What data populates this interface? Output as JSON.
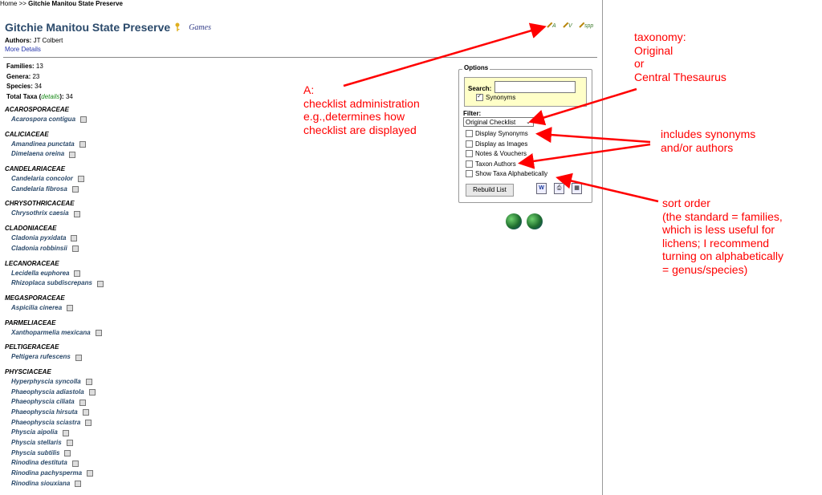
{
  "breadcrumb": {
    "home": "Home",
    "sep": ">>",
    "current": "Gitchie Manitou State Preserve"
  },
  "header": {
    "title": "Gitchie Manitou State Preserve",
    "games_label": "Games",
    "authors_label": "Authors:",
    "authors_value": "JT Colbert",
    "more_details": "More Details",
    "admin_icons": [
      {
        "icon": "edit-admin-icon",
        "label": "A"
      },
      {
        "icon": "edit-voucher-icon",
        "label": "V"
      },
      {
        "icon": "edit-app-icon",
        "label": "spp"
      }
    ]
  },
  "stats": {
    "families_label": "Families:",
    "families": "13",
    "genera_label": "Genera:",
    "genera": "23",
    "species_label": "Species:",
    "species": "34",
    "total_label": "Total Taxa (",
    "details_link": "details",
    "total_suffix": "):",
    "total": "34"
  },
  "taxa": [
    {
      "family": "ACAROSPORACEAE",
      "species": [
        "Acarospora contigua"
      ]
    },
    {
      "family": "CALICIACEAE",
      "species": [
        "Amandinea punctata",
        "Dimelaena oreina"
      ]
    },
    {
      "family": "CANDELARIACEAE",
      "species": [
        "Candelaria concolor",
        "Candelaria fibrosa"
      ]
    },
    {
      "family": "CHRYSOTHRICACEAE",
      "species": [
        "Chrysothrix caesia"
      ]
    },
    {
      "family": "CLADONIACEAE",
      "species": [
        "Cladonia pyxidata",
        "Cladonia robbinsii"
      ]
    },
    {
      "family": "LECANORACEAE",
      "species": [
        "Lecidella euphorea",
        "Rhizoplaca subdiscrepans"
      ]
    },
    {
      "family": "MEGASPORACEAE",
      "species": [
        "Aspicilia cinerea"
      ]
    },
    {
      "family": "PARMELIACEAE",
      "species": [
        "Xanthoparmelia mexicana"
      ]
    },
    {
      "family": "PELTIGERACEAE",
      "species": [
        "Peltigera rufescens"
      ]
    },
    {
      "family": "PHYSCIACEAE",
      "species": [
        "Hyperphyscia syncolla",
        "Phaeophyscia adiastola",
        "Phaeophyscia ciliata",
        "Phaeophyscia hirsuta",
        "Phaeophyscia sciastra",
        "Physcia aipolia",
        "Physcia stellaris",
        "Physcia subtilis",
        "Rinodina destituta",
        "Rinodina pachysperma",
        "Rinodina siouxiana"
      ]
    }
  ],
  "options": {
    "legend": "Options",
    "search_label": "Search:",
    "search_value": "",
    "synonyms_label": "Synonyms",
    "filter_label": "Filter:",
    "filter_value": "Original Checklist",
    "checkboxes": [
      "Display Synonyms",
      "Display as Images",
      "Notes & Vouchers",
      "Taxon Authors",
      "Show Taxa Alphabetically"
    ],
    "rebuild_label": "Rebuild List"
  },
  "annotations": {
    "a1": "A:",
    "a2": "checklist administration",
    "a3": "e.g.,determines how",
    "a4": "checklist are displayed",
    "t1": "taxonomy:",
    "t2": "Original",
    "t3": "or",
    "t4": "Central Thesaurus",
    "s1": "includes synonyms",
    "s2": "and/or authors",
    "o1": "sort order",
    "o2": "(the standard = families,",
    "o3": "which is less useful for",
    "o4": "lichens; I recommend",
    "o5": "turning on alphabetically",
    "o6": "= genus/species)"
  },
  "colors": {
    "title": "#2b4a6b",
    "annotation": "#ff0000",
    "search_bg": "#ffffc8"
  }
}
